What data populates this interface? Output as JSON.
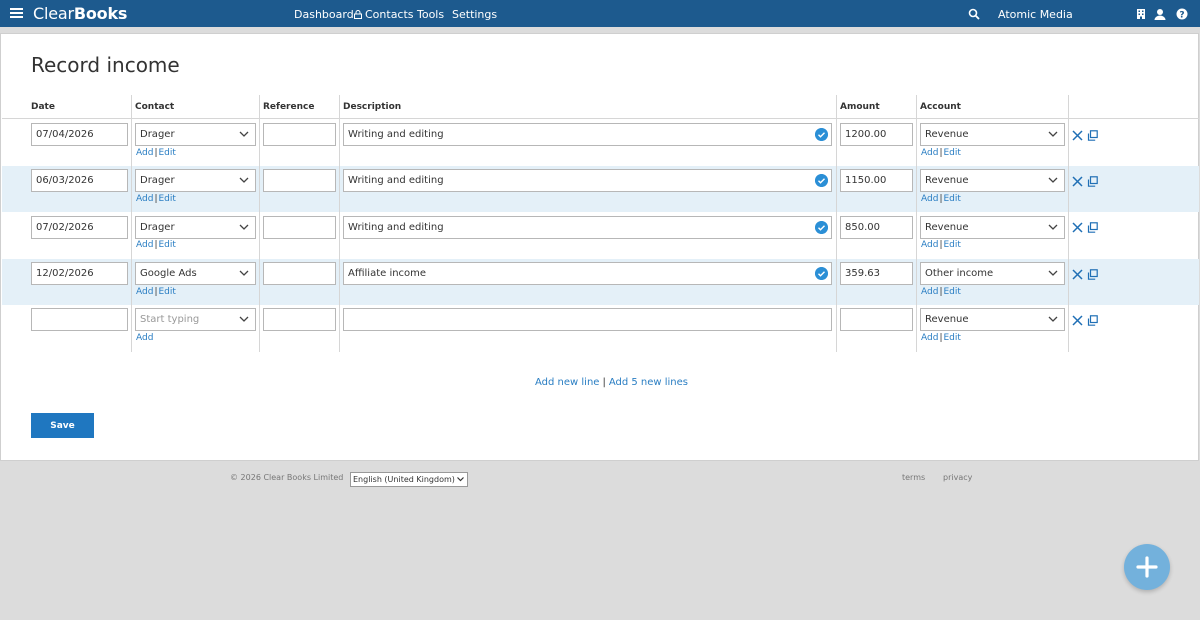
{
  "header": {
    "logo_part1": "Clear",
    "logo_part2": "Books",
    "nav": [
      "Dashboard",
      "Contacts",
      "Tools",
      "Settings"
    ],
    "company": "Atomic Media"
  },
  "page": {
    "title": "Record income"
  },
  "columns": [
    "Date",
    "Contact",
    "Reference",
    "Description",
    "Amount",
    "Account"
  ],
  "rows": [
    {
      "date": "07/04/2026",
      "contact": "Drager",
      "reference": "",
      "description": "Writing and editing",
      "amount": "1200.00",
      "account": "Revenue"
    },
    {
      "date": "06/03/2026",
      "contact": "Drager",
      "reference": "",
      "description": "Writing and editing",
      "amount": "1150.00",
      "account": "Revenue"
    },
    {
      "date": "07/02/2026",
      "contact": "Drager",
      "reference": "",
      "description": "Writing and editing",
      "amount": "850.00",
      "account": "Revenue"
    },
    {
      "date": "12/02/2026",
      "contact": "Google Ads",
      "reference": "",
      "description": "Affiliate income",
      "amount": "359.63",
      "account": "Other income"
    }
  ],
  "empty_row": {
    "contact_placeholder": "Start typing",
    "account": "Revenue"
  },
  "links": {
    "add": "Add",
    "edit": "Edit",
    "separator": "|"
  },
  "add_lines": {
    "add_new_line": "Add new line",
    "separator": "|",
    "add_5_new_lines": "Add 5 new lines"
  },
  "save_label": "Save",
  "footer": {
    "copyright": "© 2026 Clear Books Limited",
    "language": "English (United Kingdom)",
    "terms": "terms",
    "privacy": "privacy"
  },
  "colors": {
    "header_bg": "#1d5a8e",
    "accent": "#1f77c0",
    "row_alt_bg": "#e4f0f8",
    "fab": "#73b1dc"
  }
}
